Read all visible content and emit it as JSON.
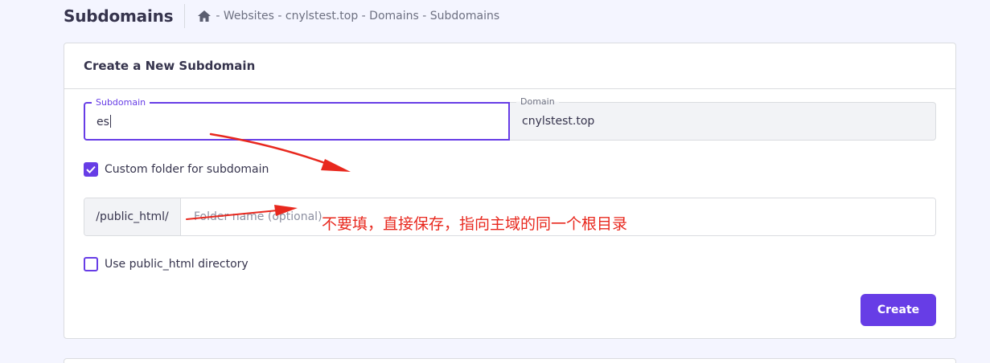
{
  "header": {
    "title": "Subdomains",
    "breadcrumb": "- Websites - cnylstest.top - Domains - Subdomains",
    "home_icon": "home-icon"
  },
  "card": {
    "title": "Create a New Subdomain",
    "subdomain": {
      "label": "Subdomain",
      "value": "es"
    },
    "domain": {
      "label": "Domain",
      "value": "cnylstest.top"
    },
    "custom_folder": {
      "label": "Custom folder for subdomain",
      "checked": true
    },
    "folder": {
      "prefix": "/public_html/",
      "placeholder": "Folder name (optional)",
      "value": ""
    },
    "public_html": {
      "label": "Use public_html directory",
      "checked": false
    },
    "create_label": "Create"
  },
  "annotation": {
    "text": "不要填，直接保存，指向主域的同一个根目录",
    "color": "#e8281e"
  },
  "colors": {
    "accent": "#673de6",
    "background": "#f4f5ff",
    "annotation": "#e8281e"
  }
}
